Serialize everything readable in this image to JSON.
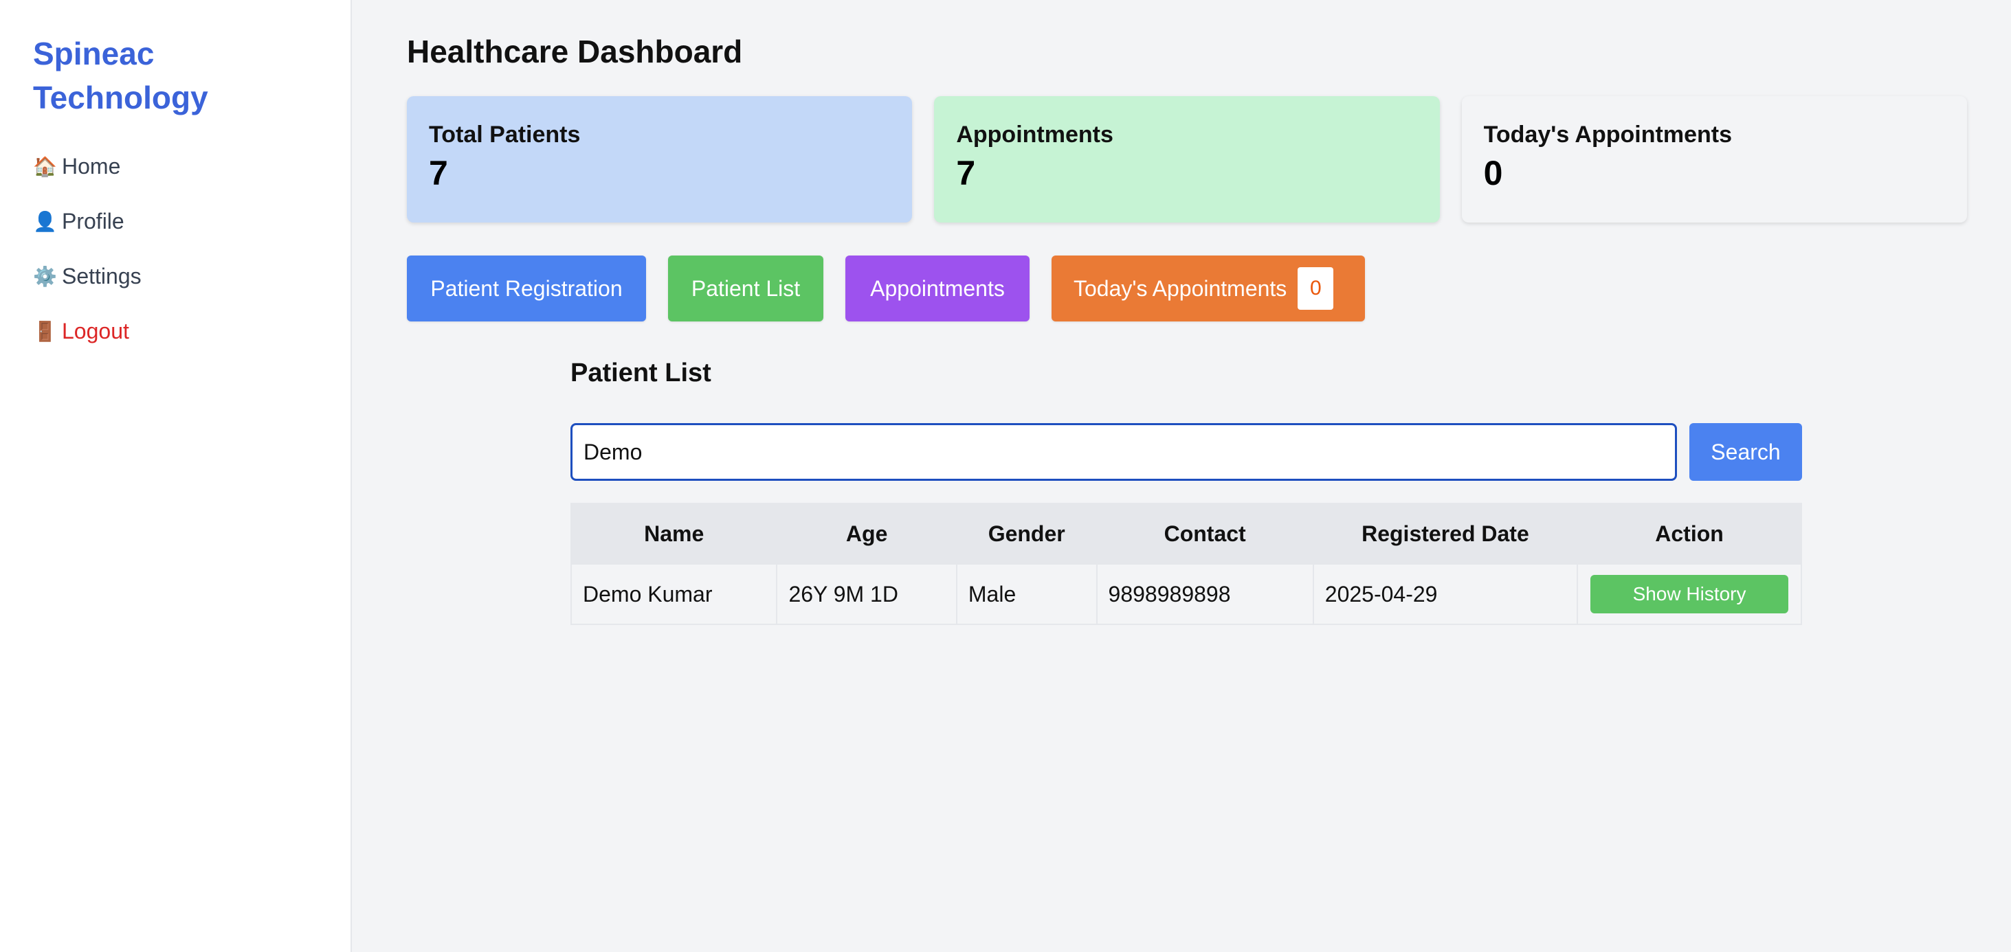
{
  "sidebar": {
    "brand_line1": "Spineac",
    "brand_line2": "Technology",
    "items": [
      {
        "icon": "🏠",
        "icon_name": "home-icon",
        "label": "Home"
      },
      {
        "icon": "👤",
        "icon_name": "user-icon",
        "label": "Profile"
      },
      {
        "icon": "⚙️",
        "icon_name": "gear-icon",
        "label": "Settings"
      },
      {
        "icon": "🚪",
        "icon_name": "door-icon",
        "label": "Logout"
      }
    ]
  },
  "header": {
    "title": "Healthcare Dashboard"
  },
  "cards": [
    {
      "label": "Total Patients",
      "value": "7",
      "color": "#c3d8f8"
    },
    {
      "label": "Appointments",
      "value": "7",
      "color": "#c6f3d4"
    },
    {
      "label": "Today's Appointments",
      "value": "0",
      "color": "#f3f4f6"
    }
  ],
  "actions": {
    "registration": "Patient Registration",
    "patient_list": "Patient List",
    "appointments": "Appointments",
    "todays_appointments": "Today's Appointments",
    "todays_count": "0"
  },
  "patient_list": {
    "title": "Patient List",
    "search_value": "Demo",
    "search_button": "Search",
    "columns": [
      "Name",
      "Age",
      "Gender",
      "Contact",
      "Registered Date",
      "Action"
    ],
    "rows": [
      {
        "name": "Demo Kumar",
        "age": "26Y 9M 1D",
        "gender": "Male",
        "contact": "9898989898",
        "registered_date": "2025-04-29",
        "action": "Show History"
      }
    ]
  },
  "colors": {
    "brand": "#3b63d9",
    "logout": "#dc2626",
    "blue_button": "#4b82f0",
    "green_button": "#5cc463",
    "purple_button": "#9d52ee",
    "orange_button": "#ea7a35"
  }
}
